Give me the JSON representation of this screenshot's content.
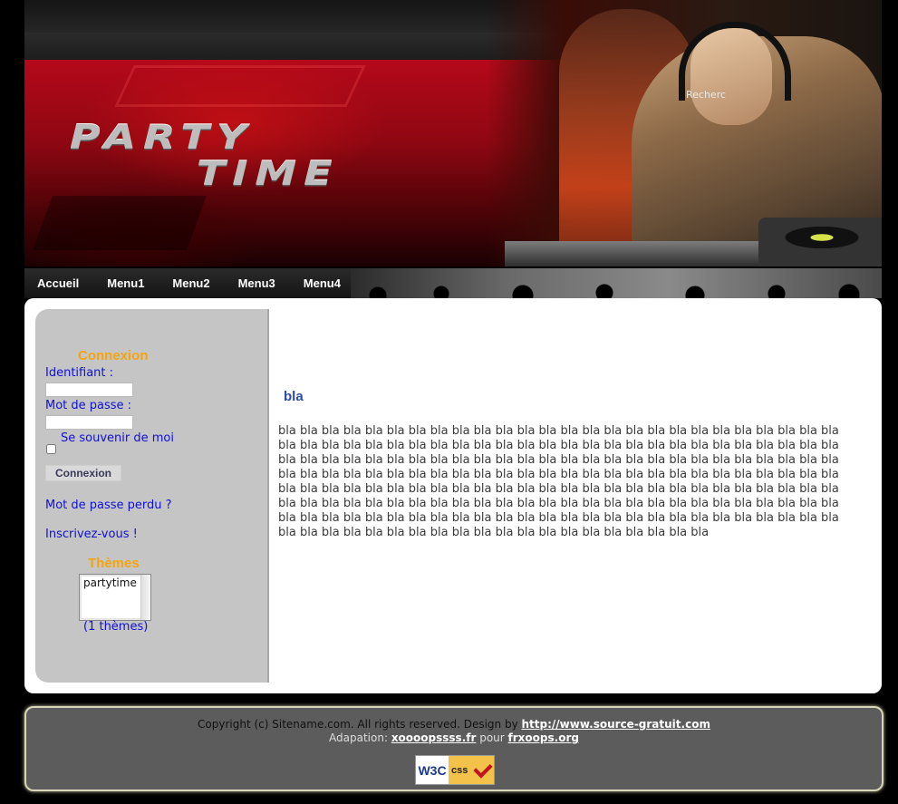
{
  "header": {
    "logo_line1": "PARTY",
    "logo_line2": "TIME",
    "search_label": "Recherc"
  },
  "nav": {
    "items": [
      "Accueil",
      "Menu1",
      "Menu2",
      "Menu3",
      "Menu4"
    ]
  },
  "sidebar": {
    "login_title": "Connexion",
    "username_label": "Identifiant :",
    "username_value": "",
    "password_label": "Mot de passe :",
    "password_value": "",
    "remember_label": "Se souvenir de moi",
    "remember_checked": false,
    "login_button": "Connexion",
    "lost_password": "Mot de passe perdu ?",
    "register": "Inscrivez-vous !",
    "themes_title": "Thèmes",
    "themes_selected": "partytime",
    "themes_count": "(1 thèmes)"
  },
  "main": {
    "title": "bla",
    "body": "bla bla bla bla bla bla bla bla bla bla bla bla bla bla bla bla bla bla bla bla bla bla bla bla bla bla bla bla bla bla bla bla bla bla bla bla bla bla bla bla bla bla bla bla bla bla bla bla bla bla bla bla bla bla bla bla bla bla bla bla bla bla bla bla bla bla bla bla bla bla bla bla bla bla bla bla bla bla bla bla bla bla bla bla bla bla bla bla bla bla bla bla bla bla bla bla bla bla bla bla bla bla bla bla bla bla bla bla bla bla bla bla bla bla bla bla bla bla bla bla bla bla bla bla bla bla bla bla bla bla bla bla bla bla bla bla bla bla bla bla bla bla bla bla bla bla bla bla bla bla bla bla bla bla bla bla bla bla bla bla bla bla bla bla bla bla bla bla bla bla bla bla bla bla bla bla bla bla bla bla bla bla bla bla bla bla bla bla bla bla bla bla bla bla bla bla bla bla bla bla bla bla"
  },
  "footer": {
    "copyright": "Copyright (c) Sitename.com. All rights reserved. Design by",
    "design_link": "http://www.source-gratuit.com",
    "adaptation_label": "Adapation:",
    "adaptation_link": "xoooopssss.fr",
    "pour": "pour",
    "frxoops_link": "frxoops.org",
    "badge_w3c": "W3C",
    "badge_css": "css"
  },
  "colors": {
    "header_red": "#b5091a",
    "side_title": "#f5a40f",
    "side_link": "#1010d8",
    "main_title": "#2b4aa8",
    "footer_bg": "#5c5c5c"
  }
}
